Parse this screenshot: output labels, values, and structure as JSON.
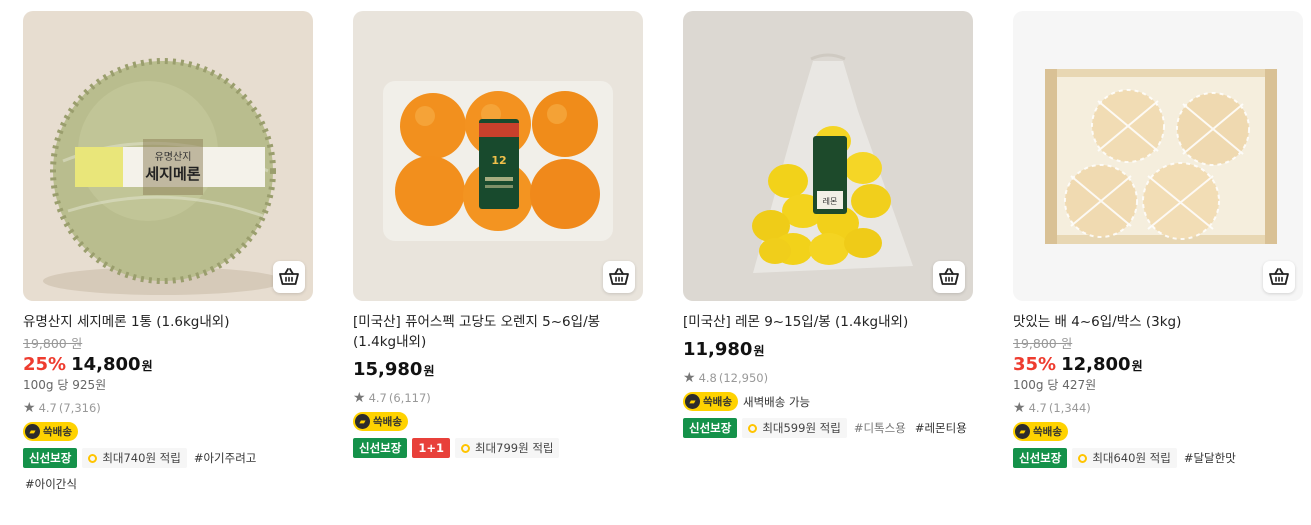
{
  "products": [
    {
      "title": "유명산지 세지메론 1통 (1.6kg내외)",
      "original_price": "19,800 원",
      "discount": "25%",
      "price": "14,800",
      "currency": "원",
      "unit_price": "100g 당 925원",
      "rating": "4.7",
      "review_count": "(7,316)",
      "delivery_badge": "쓱배송",
      "fresh_tag": "신선보장",
      "point_tag": "최대740원 적립",
      "hashtags": [
        "#아기주려고",
        "#아이간식"
      ],
      "image_label_line1": "유명산지",
      "image_label_line2": "세지메론"
    },
    {
      "title": "[미국산] 퓨어스펙 고당도 오렌지 5~6입/봉 (1.4kg내외)",
      "price": "15,980",
      "currency": "원",
      "rating": "4.7",
      "review_count": "(6,117)",
      "delivery_badge": "쓱배송",
      "fresh_tag": "신선보장",
      "promo_tag": "1+1",
      "point_tag": "최대799원 적립",
      "image_label": "12"
    },
    {
      "title": "[미국산] 레몬 9~15입/봉 (1.4kg내외)",
      "price": "11,980",
      "currency": "원",
      "rating": "4.8",
      "review_count": "(12,950)",
      "delivery_badge": "쓱배송",
      "delivery_note": "새벽배송 가능",
      "fresh_tag": "신선보장",
      "point_tag": "최대599원 적립",
      "hashtags": [
        "#디톡스용",
        "#레몬티용"
      ],
      "image_label": "레몬"
    },
    {
      "title": "맛있는 배 4~6입/박스 (3kg)",
      "original_price": "19,800 원",
      "discount": "35%",
      "price": "12,800",
      "currency": "원",
      "unit_price": "100g 당 427원",
      "rating": "4.7",
      "review_count": "(1,344)",
      "delivery_badge": "쓱배송",
      "fresh_tag": "신선보장",
      "point_tag": "최대640원 적립",
      "hashtags": [
        "#달달한맛"
      ]
    }
  ],
  "icons": {
    "cart": "basket-icon",
    "star": "star-icon",
    "delivery": "truck-icon",
    "point": "coin-icon"
  },
  "colors": {
    "discount": "#ee3c2f",
    "fresh": "#14924a",
    "promo": "#e8403a",
    "ssg_badge": "#ffd200"
  }
}
